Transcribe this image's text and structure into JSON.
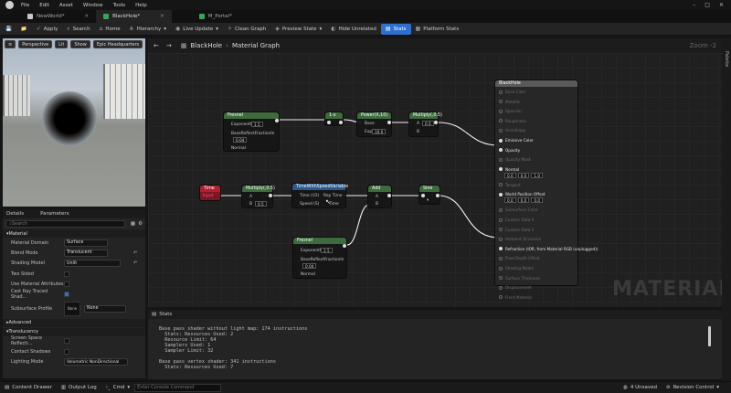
{
  "menu": [
    "File",
    "Edit",
    "Asset",
    "Window",
    "Tools",
    "Help"
  ],
  "tabs": [
    {
      "label": "NewWorld*",
      "color": "#c8c8c8"
    },
    {
      "label": "BlackHole*",
      "color": "#3aa35a"
    },
    {
      "label": "M_Portal*",
      "color": "#3aa35a"
    }
  ],
  "toolbar": [
    {
      "label": "Apply",
      "icon": "check-icon"
    },
    {
      "label": "Search",
      "icon": "search-icon"
    },
    {
      "label": "Home",
      "icon": "home-icon"
    },
    {
      "label": "Hierarchy",
      "icon": "hierarchy-icon"
    },
    {
      "label": "Live Update",
      "icon": "live-update-icon"
    },
    {
      "label": "Clean Graph",
      "icon": "clean-graph-icon"
    },
    {
      "label": "Preview State",
      "icon": "preview-icon"
    },
    {
      "label": "Hide Unrelated",
      "icon": "hide-icon"
    },
    {
      "label": "Stats",
      "icon": "stats-icon",
      "active": true
    },
    {
      "label": "Platform Stats",
      "icon": "platform-stats-icon"
    }
  ],
  "viewport": {
    "buttons": [
      "Perspective",
      "Lit",
      "Show",
      "Epic Headquarters"
    ]
  },
  "details": {
    "tab1": "Details",
    "tab2": "Parameters",
    "search_placeholder": "Search",
    "material_section": "Material",
    "props": [
      {
        "label": "Material Domain",
        "value": "Surface"
      },
      {
        "label": "Blend Mode",
        "value": "Translucent"
      },
      {
        "label": "Shading Model",
        "value": "Unlit"
      }
    ],
    "checks": [
      {
        "label": "Two Sided",
        "on": false
      },
      {
        "label": "Use Material Attributes",
        "on": false
      },
      {
        "label": "Cast Ray Traced Shad...",
        "on": true
      }
    ],
    "subsurface_label": "Subsurface Profile",
    "subsurface_thumb": "None",
    "subsurface_value": "None",
    "advanced": "Advanced",
    "translucency": "Translucency",
    "trans_rows": [
      {
        "label": "Screen Space Reflecti..."
      },
      {
        "label": "Contact Shadows"
      },
      {
        "label": "Lighting Mode",
        "value": "Volumetric NonDirectional"
      }
    ]
  },
  "graph": {
    "breadcrumb_root": "BlackHole",
    "breadcrumb_child": "Material Graph",
    "zoom": "Zoom -2",
    "watermark": "MATERIAL",
    "palette": "Palette",
    "nodes": {
      "fresnel1": {
        "title": "Fresnel",
        "pins": [
          "ExponentIn",
          "BaseReflectFractionIn",
          "Normal"
        ],
        "v1": "1.5",
        "v2": "0.04"
      },
      "one_minus": {
        "title": "1-x"
      },
      "power": {
        "title": "Power(X,10)",
        "pins": [
          "Base",
          "Exp"
        ],
        "v1": "10.0"
      },
      "mult1": {
        "title": "Multiply(,0.5)",
        "pins": [
          "A",
          "B"
        ],
        "v1": "0.5"
      },
      "time": {
        "title": "Time",
        "sub": "Input"
      },
      "mult2": {
        "title": "Multiply(,0.5)",
        "pins": [
          "A",
          "B"
        ],
        "v1": "0.5"
      },
      "tovs": {
        "title": "TimeWithSpeedVariable",
        "pins": [
          "Time (V2)",
          "Speed (S)",
          "Rep Time",
          "Time"
        ]
      },
      "add": {
        "title": "Add",
        "pins": [
          "A",
          "B"
        ]
      },
      "sine": {
        "title": "Sine"
      },
      "fresnel2": {
        "title": "Fresnel",
        "pins": [
          "ExponentIn",
          "BaseReflectFractionIn",
          "Normal"
        ],
        "v1": "2.5",
        "v2": "0.04"
      },
      "result": {
        "title": "BlackHole",
        "pins": [
          "Base Color",
          "Metallic",
          "Specular",
          "Roughness",
          "Anisotropy",
          "Emissive Color",
          "Opacity",
          "Opacity Mask",
          "Normal",
          "Tangent",
          "World Position Offset",
          "Subsurface Color",
          "Custom Data 0",
          "Custom Data 1",
          "Ambient Occlusion",
          "Refraction (IOR, from Material RGB (unplugged))",
          "Pixel Depth Offset",
          "Shading Model",
          "Surface Thickness",
          "Displacement",
          "Front Material"
        ],
        "normal_vals": [
          "0.0",
          "0.0",
          "1.0"
        ],
        "wpo_vals": [
          "0.0",
          "0.0",
          "0.0"
        ]
      }
    }
  },
  "stats": {
    "title": "Stats",
    "lines": [
      "Base pass shader without light map: 174 instructions",
      "  Stats: Resources Used: 2",
      "  Resource Limit: 64",
      "  Samplers Used: 1",
      "  Sampler Limit: 32",
      "",
      "Base pass vertex shader: 341 instructions",
      "  Stats: Resources Used: 7"
    ]
  },
  "statusbar": {
    "content_drawer": "Content Drawer",
    "output_log": "Output Log",
    "cmd": "Cmd",
    "console_placeholder": "Enter Console Command",
    "unsaved": "4 Unsaved",
    "revision": "Revision Control"
  }
}
